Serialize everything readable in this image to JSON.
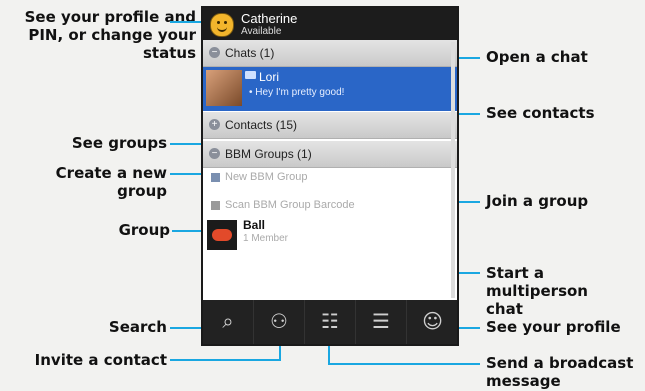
{
  "callouts": {
    "profile_pin": "See your profile and\nPIN, or change your\nstatus",
    "see_groups": "See groups",
    "create_group": "Create a new group",
    "group": "Group",
    "search": "Search",
    "invite_contact": "Invite a contact",
    "open_chat": "Open a chat",
    "see_contacts": "See contacts",
    "join_group": "Join a group",
    "start_multiperson": "Start a multiperson\nchat",
    "see_your_profile": "See your profile",
    "send_broadcast": "Send a broadcast\nmessage"
  },
  "screen": {
    "user": {
      "name": "Catherine",
      "status": "Available",
      "icon": "smiley-avatar-icon"
    },
    "sections": {
      "chats": "Chats (1)",
      "contacts": "Contacts (15)",
      "groups": "BBM Groups (1)"
    },
    "chat": {
      "name": "Lori",
      "message": "Hey I'm pretty good!"
    },
    "actions": {
      "new_group": "New BBM Group",
      "scan_barcode": "Scan BBM Group Barcode"
    },
    "group": {
      "name": "Ball",
      "members": "1 Member"
    },
    "bottom_bar": [
      {
        "name": "search",
        "icon": "search-icon"
      },
      {
        "name": "invite",
        "icon": "add-contact-icon"
      },
      {
        "name": "broadcast",
        "icon": "broadcast-message-icon"
      },
      {
        "name": "multiperson",
        "icon": "multiperson-chat-icon"
      },
      {
        "name": "profile",
        "icon": "profile-icon"
      }
    ]
  },
  "colors": {
    "accent_line": "#1aa7e1",
    "selected_row": "#2a66c7",
    "topbar": "#1c1c1c"
  }
}
